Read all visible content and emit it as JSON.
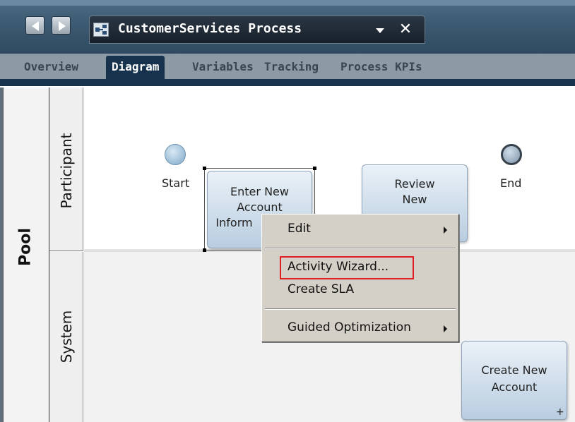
{
  "window": {
    "title": "CustomerServices Process",
    "nav_back_icon": "arrow-left-icon",
    "nav_forward_icon": "arrow-right-icon",
    "close_symbol": "✕"
  },
  "tabs": [
    {
      "label": "Overview",
      "active": false
    },
    {
      "label": "Diagram",
      "active": true
    },
    {
      "label": "Variables",
      "active": false
    },
    {
      "label": "Tracking",
      "active": false
    },
    {
      "label": "Process KPIs",
      "active": false
    }
  ],
  "diagram": {
    "pool": {
      "label": "Pool"
    },
    "lanes": [
      {
        "label": "Participant"
      },
      {
        "label": "System"
      }
    ],
    "events": {
      "start": {
        "label": "Start"
      },
      "end": {
        "label": "End"
      }
    },
    "activities": [
      {
        "lines": [
          "Enter New",
          "Account",
          "Inform"
        ]
      },
      {
        "lines": [
          "Review",
          "New",
          ""
        ]
      },
      {
        "lines": [
          "Create New",
          "Account"
        ],
        "badge": "+"
      }
    ]
  },
  "context_menu": {
    "items": [
      {
        "label": "Edit",
        "has_submenu": true
      },
      {
        "label": "Activity Wizard...",
        "has_submenu": false,
        "highlighted": true
      },
      {
        "label": "Create SLA",
        "has_submenu": false
      },
      {
        "label": "Guided Optimization",
        "has_submenu": true
      }
    ]
  },
  "colors": {
    "titlebar": "#3c5a72",
    "active_tab": "#17324d",
    "activity_fill": "#b9cde0",
    "menu_bg": "#d4d0c8",
    "highlight": "#e02020"
  }
}
